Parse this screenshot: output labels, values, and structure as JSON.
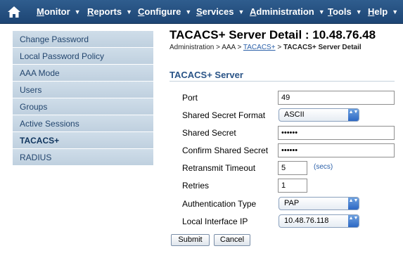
{
  "menu": {
    "items": [
      {
        "label": "Monitor",
        "underline": "M",
        "rest": "onitor"
      },
      {
        "label": "Reports",
        "underline": "R",
        "rest": "eports"
      },
      {
        "label": "Configure",
        "underline": "C",
        "rest": "onfigure"
      },
      {
        "label": "Services",
        "underline": "S",
        "rest": "ervices"
      },
      {
        "label": "Administration",
        "underline": "A",
        "rest": "dministration"
      },
      {
        "label": "Tools",
        "underline": "T",
        "rest": "ools"
      },
      {
        "label": "Help",
        "underline": "H",
        "rest": "elp"
      }
    ],
    "caret": "▼"
  },
  "sidebar": {
    "items": [
      {
        "label": "Change Password"
      },
      {
        "label": "Local Password Policy"
      },
      {
        "label": "AAA Mode"
      },
      {
        "label": "Users"
      },
      {
        "label": "Groups"
      },
      {
        "label": "Active Sessions"
      },
      {
        "label": "TACACS+"
      },
      {
        "label": "RADIUS"
      }
    ],
    "active_index": 6
  },
  "page": {
    "title": "TACACS+ Server Detail : 10.48.76.48",
    "breadcrumb": {
      "part1": "Administration > AAA > ",
      "link": "TACACS+",
      "sep": " > ",
      "current": "TACACS+ Server Detail"
    },
    "section_title": "TACACS+ Server"
  },
  "form": {
    "port": {
      "label": "Port",
      "value": "49"
    },
    "secret_format": {
      "label": "Shared Secret Format",
      "value": "ASCII"
    },
    "shared_secret": {
      "label": "Shared Secret",
      "value": "••••••"
    },
    "confirm_secret": {
      "label": "Confirm Shared Secret",
      "value": "••••••"
    },
    "retransmit": {
      "label": "Retransmit Timeout",
      "value": "5",
      "units": "(secs)"
    },
    "retries": {
      "label": "Retries",
      "value": "1"
    },
    "auth_type": {
      "label": "Authentication Type",
      "value": "PAP"
    },
    "local_ip": {
      "label": "Local Interface IP",
      "value": "10.48.76.118"
    }
  },
  "buttons": {
    "submit": "Submit",
    "cancel": "Cancel"
  },
  "icons": {
    "stepper": "▲▼"
  }
}
